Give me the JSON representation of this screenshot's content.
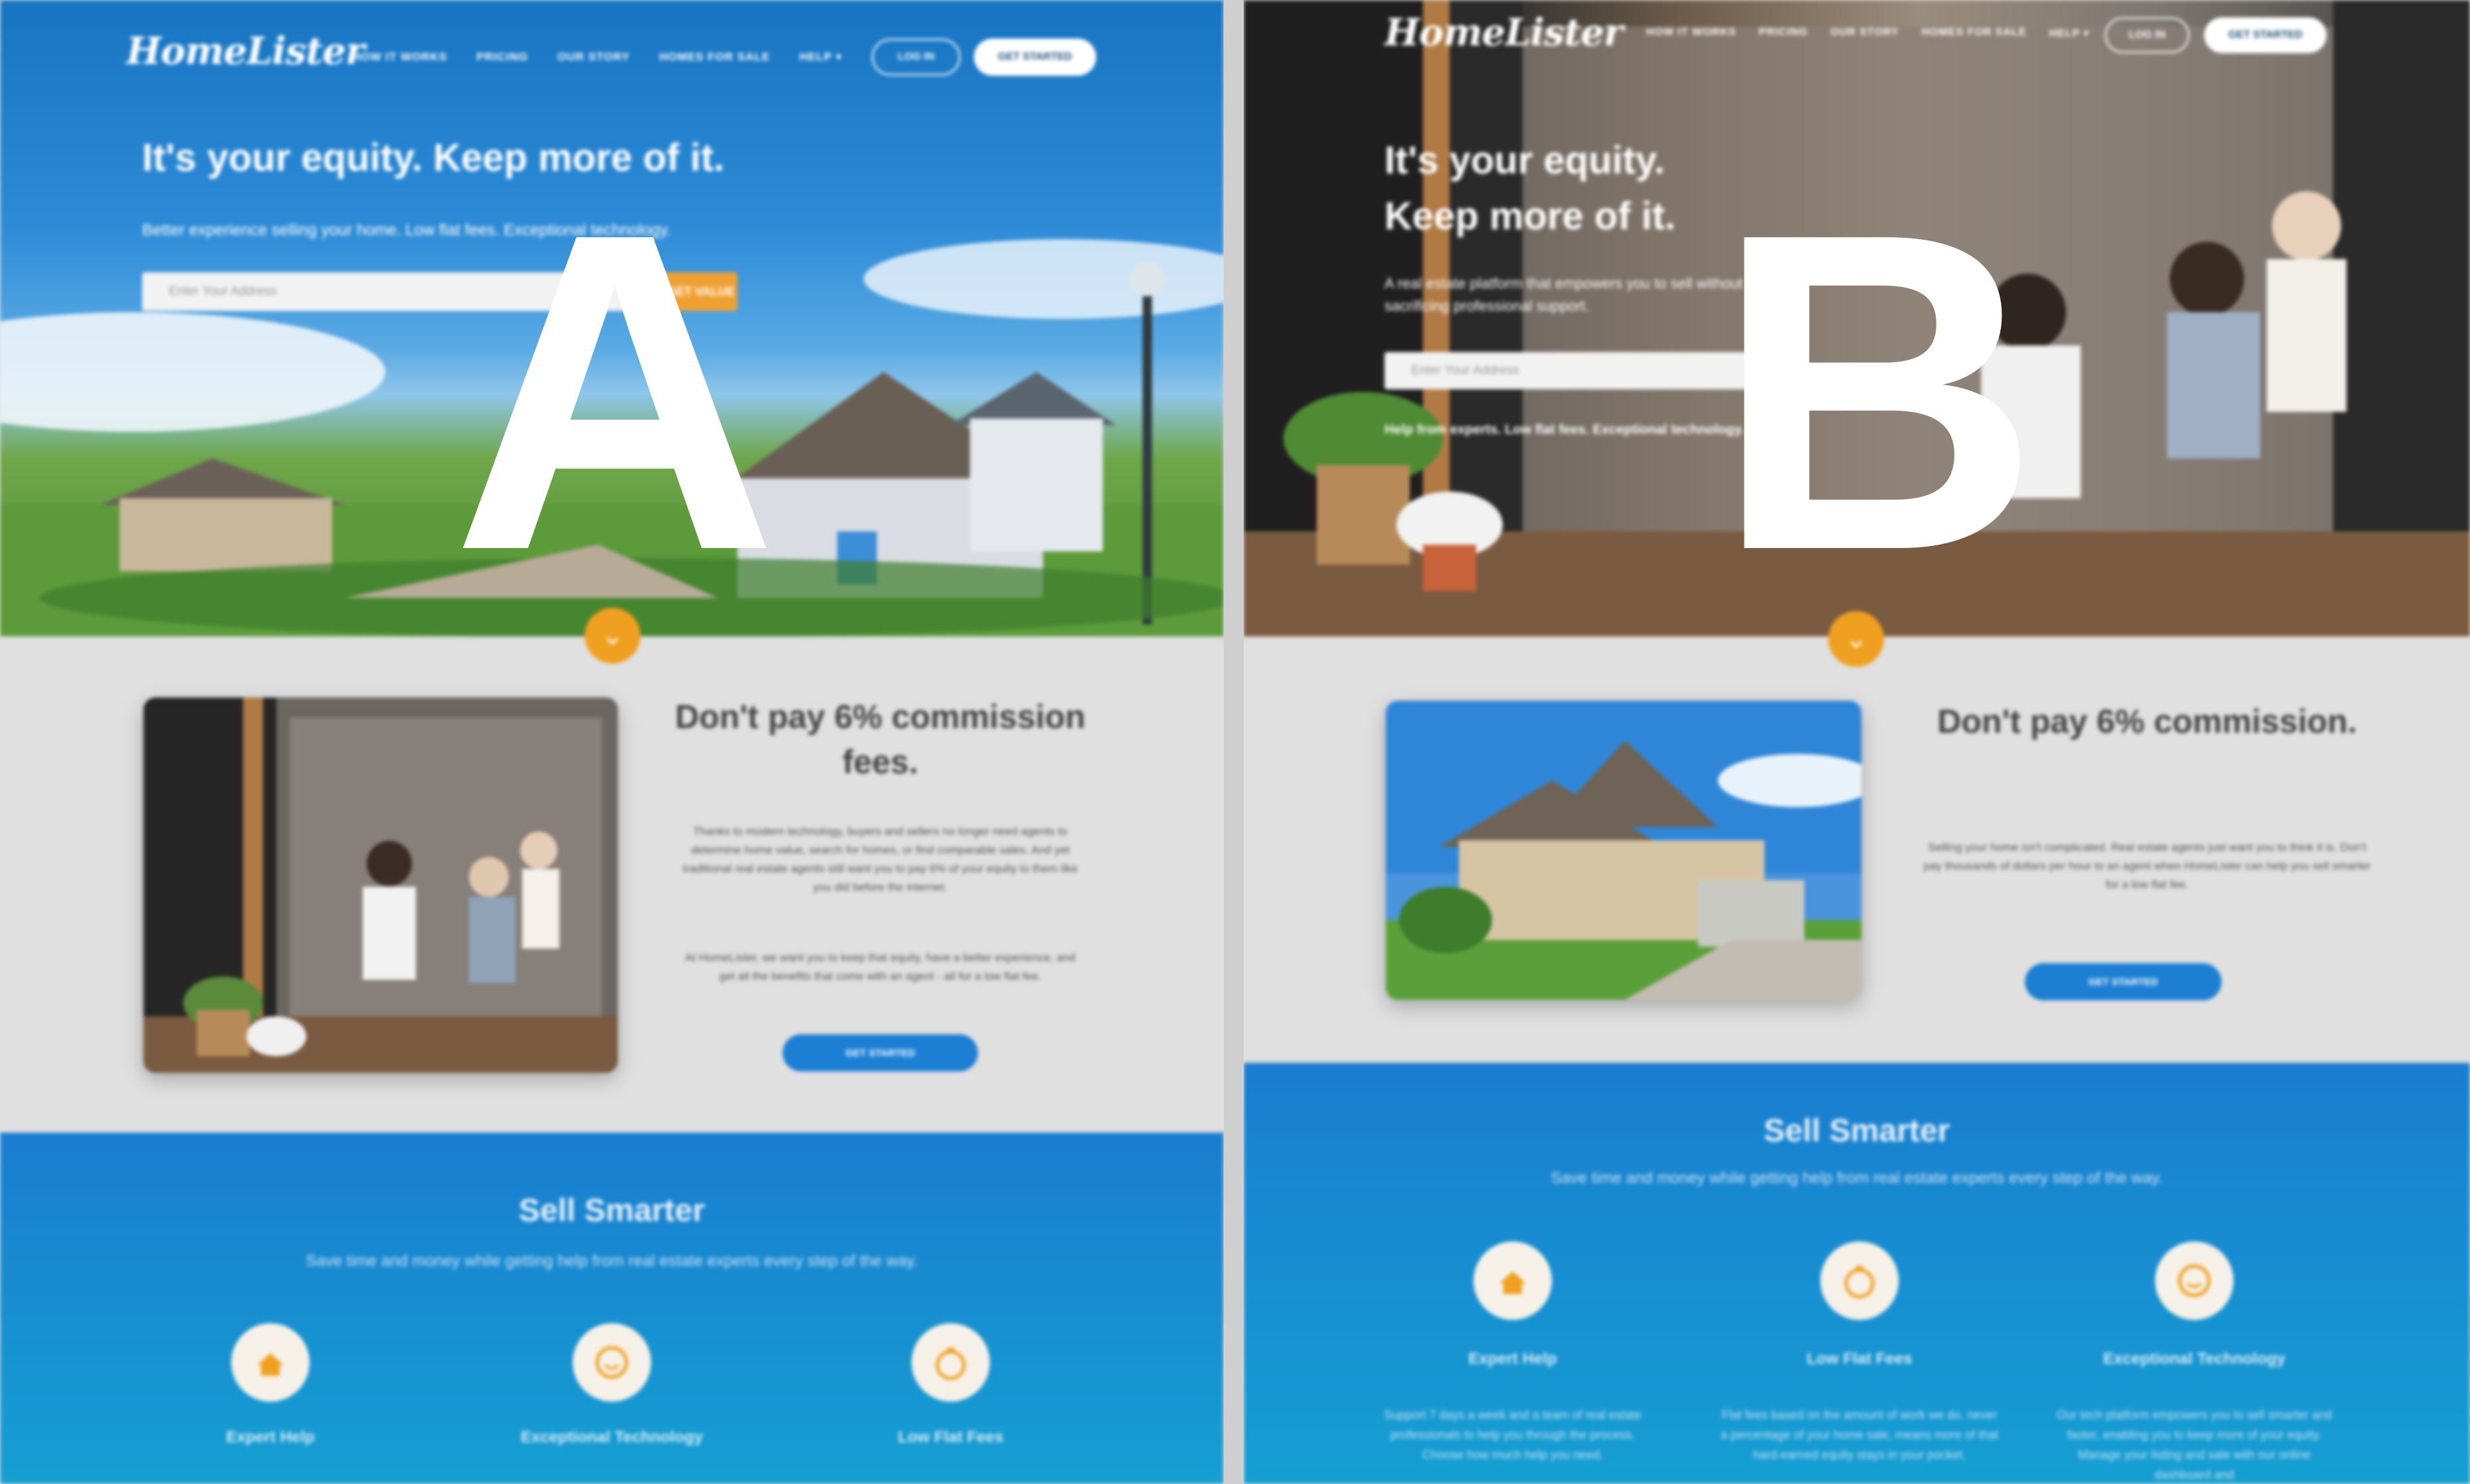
{
  "labels": {
    "a": "A",
    "b": "B"
  },
  "variant_a": {
    "logo": "HomeLister",
    "nav": [
      "HOW IT WORKS",
      "PRICING",
      "OUR STORY",
      "HOMES FOR SALE",
      "HELP ▾"
    ],
    "login": "LOG IN",
    "get_started": "GET STARTED",
    "hero_title": "It's your equity. Keep more of it.",
    "hero_sub": "Better experience selling your home. Low flat fees. Exceptional technology.",
    "address_placeholder": "Enter Your Address",
    "address_button": "GET VALUE",
    "section_title": "Don't pay 6% commission fees.",
    "section_p1": "Thanks to modern technology, buyers and sellers no longer need agents to determine home value, search for homes, or find comparable sales. And yet traditional real estate agents still want you to pay 6% of your equity to them like you did before the internet.",
    "section_p2": "At HomeLister, we want you to keep that equity, have a better experience, and get all the benefits that come with an agent - all for a low flat fee.",
    "section_button": "GET STARTED",
    "sell_title": "Sell Smarter",
    "sell_sub": "Save time and money while getting help from real estate experts every step of the way.",
    "features": [
      "Expert Help",
      "Exceptional Technology",
      "Low Flat Fees"
    ]
  },
  "variant_b": {
    "logo": "HomeLister",
    "nav": [
      "HOW IT WORKS",
      "PRICING",
      "OUR STORY",
      "HOMES FOR SALE",
      "HELP ▾"
    ],
    "login": "LOG IN",
    "get_started": "GET STARTED",
    "hero_title_1": "It's your equity.",
    "hero_title_2": "Keep more of it.",
    "hero_sub": "A real estate platform that empowers you to sell without sacrificing professional support.",
    "address_placeholder": "Enter Your Address",
    "hero_bottom": "Help from experts. Low flat fees. Exceptional technology.",
    "section_title": "Don't pay 6% commission.",
    "section_p1": "Selling your home isn't complicated. Real estate agents just want you to think it is. Don't pay thousands of dollars per hour to an agent when HomeLister can help you sell smarter for a low flat fee.",
    "section_button": "GET STARTED",
    "sell_title": "Sell Smarter",
    "sell_sub": "Save time and money while getting help from real estate experts every step of the way.",
    "features": [
      {
        "label": "Expert Help",
        "text": "Support 7 days a week and a team of real estate professionals to help you through the process. Choose how much help you need."
      },
      {
        "label": "Low Flat Fees",
        "text": "Flat fees based on the amount of work we do, never a percentage of your home sale, means more of that hard-earned equity stays in your pocket."
      },
      {
        "label": "Exceptional Technology",
        "text": "Our tech platform empowers you to sell smarter and faster, enabling you to keep more of your equity. Manage your listing and sale with our online dashboard and"
      }
    ]
  },
  "colors": {
    "brand_blue": "#1c7fd4",
    "accent_orange": "#f0a020"
  }
}
